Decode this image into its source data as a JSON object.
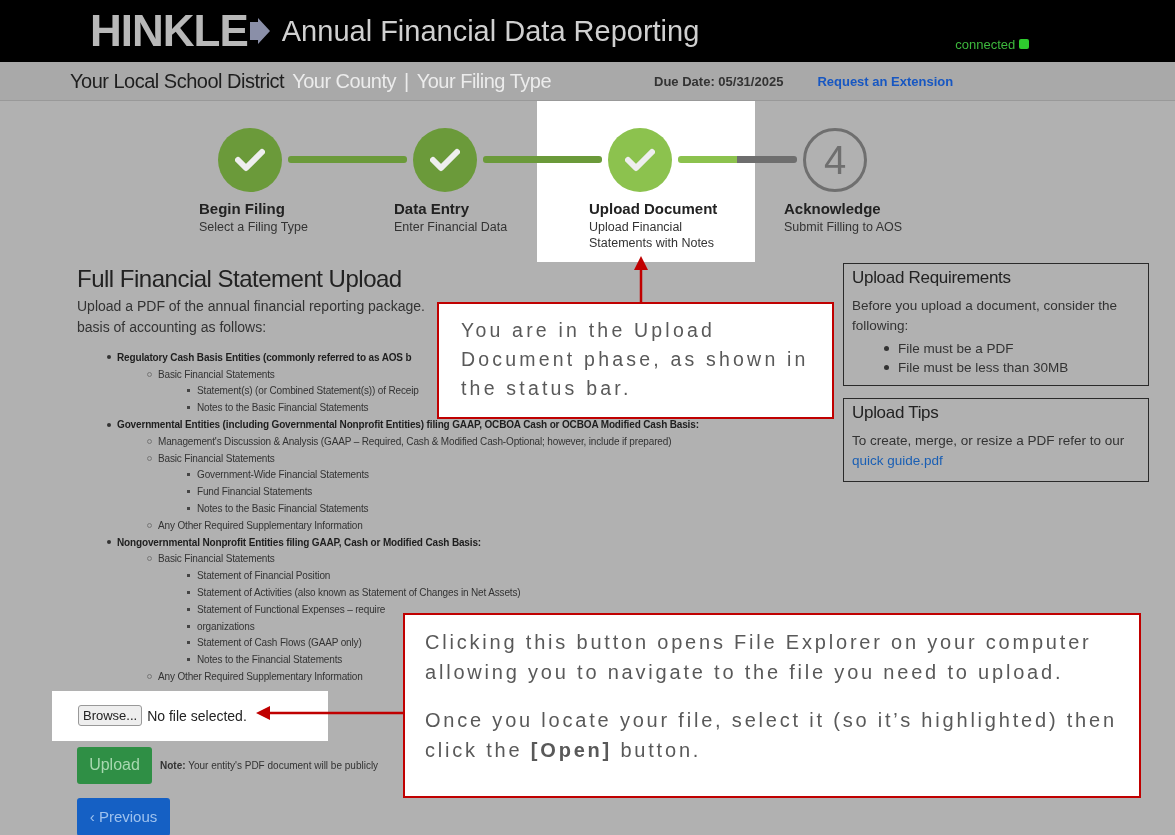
{
  "header": {
    "logo": "HINKLE",
    "title": "Annual Financial Data Reporting",
    "connection": "connected"
  },
  "context_bar": {
    "district": "Your Local School District",
    "county": "Your County",
    "separator": "|",
    "filing_type": "Your Filing Type",
    "due_date": "Due Date: 05/31/2025",
    "extension_link": "Request an Extension"
  },
  "steps": [
    {
      "title": "Begin Filing",
      "subtitle": "Select a Filing Type",
      "completed": true,
      "highlighted": false
    },
    {
      "title": "Data Entry",
      "subtitle": "Enter Financial Data",
      "completed": true,
      "highlighted": false
    },
    {
      "title": "Upload Document",
      "subtitle": "Upload Financial Statements with Notes",
      "completed": true,
      "highlighted": true
    },
    {
      "number": "4",
      "title": "Acknowledge",
      "subtitle": "Submit Filling to AOS",
      "completed": false,
      "highlighted": false
    }
  ],
  "heading": "Full Financial Statement Upload",
  "intro": "Upload a PDF of the annual financial reporting package.",
  "intro_2": "basis of accounting as follows:",
  "requirements_list": [
    {
      "text": "Regulatory Cash Basis Entities (commonly referred to as AOS b",
      "children": [
        {
          "text": "Basic Financial Statements",
          "children": [
            {
              "text": "Statement(s) (or Combined Statement(s)) of Receip"
            },
            {
              "text": "Notes to the Basic Financial Statements"
            }
          ]
        }
      ]
    },
    {
      "text": "Governmental Entities (including Governmental Nonprofit Entities) filing GAAP, OCBOA Cash or OCBOA Modified Cash Basis:",
      "children": [
        {
          "text": "Management's Discussion & Analysis (GAAP – Required, Cash & Modified Cash-Optional; however, include if prepared)"
        },
        {
          "text": "Basic Financial Statements",
          "children": [
            {
              "text": "Government-Wide Financial Statements"
            },
            {
              "text": "Fund Financial Statements"
            },
            {
              "text": "Notes to the Basic Financial Statements"
            }
          ]
        },
        {
          "text": "Any Other Required Supplementary Information"
        }
      ]
    },
    {
      "text": "Nongovernmental Nonprofit Entities filing GAAP, Cash or Modified Cash Basis:",
      "children": [
        {
          "text": "Basic Financial Statements",
          "children": [
            {
              "text": "Statement of Financial Position"
            },
            {
              "text": "Statement of Activities (also known as Statement of Changes in Net Assets)"
            },
            {
              "text": "Statement of Functional Expenses – require"
            },
            {
              "text": "organizations"
            },
            {
              "text": "Statement of Cash Flows (GAAP only)"
            },
            {
              "text": "Notes to the Financial Statements"
            }
          ]
        },
        {
          "text": "Any Other Required Supplementary Information"
        }
      ]
    }
  ],
  "file_input": {
    "button": "Browse...",
    "value": "No file selected.",
    "highlighted": true
  },
  "upload_button": "Upload",
  "note": "**Note:** Your entity's PDF document will be publicly",
  "previous_button": "‹ Previous",
  "sidebar": [
    {
      "title": "Upload Requirements",
      "text": "Before you upload a document, consider the following:",
      "bullets": [
        "File must be a PDF",
        "File must be less than 30MB"
      ]
    },
    {
      "title": "Upload Tips",
      "text": "To create, merge, or resize a PDF refer to our",
      "link": "quick guide.pdf"
    }
  ],
  "callouts": [
    {
      "paragraphs": [
        "You are in the Upload Document phase, as shown in the status bar."
      ]
    },
    {
      "paragraphs": [
        "Clicking this button opens File Explorer on your computer allowing you to navigate to the file you need to upload.",
        "Once you locate your file, select it (so it’s highlighted) then click the **[Open]** button."
      ]
    }
  ]
}
